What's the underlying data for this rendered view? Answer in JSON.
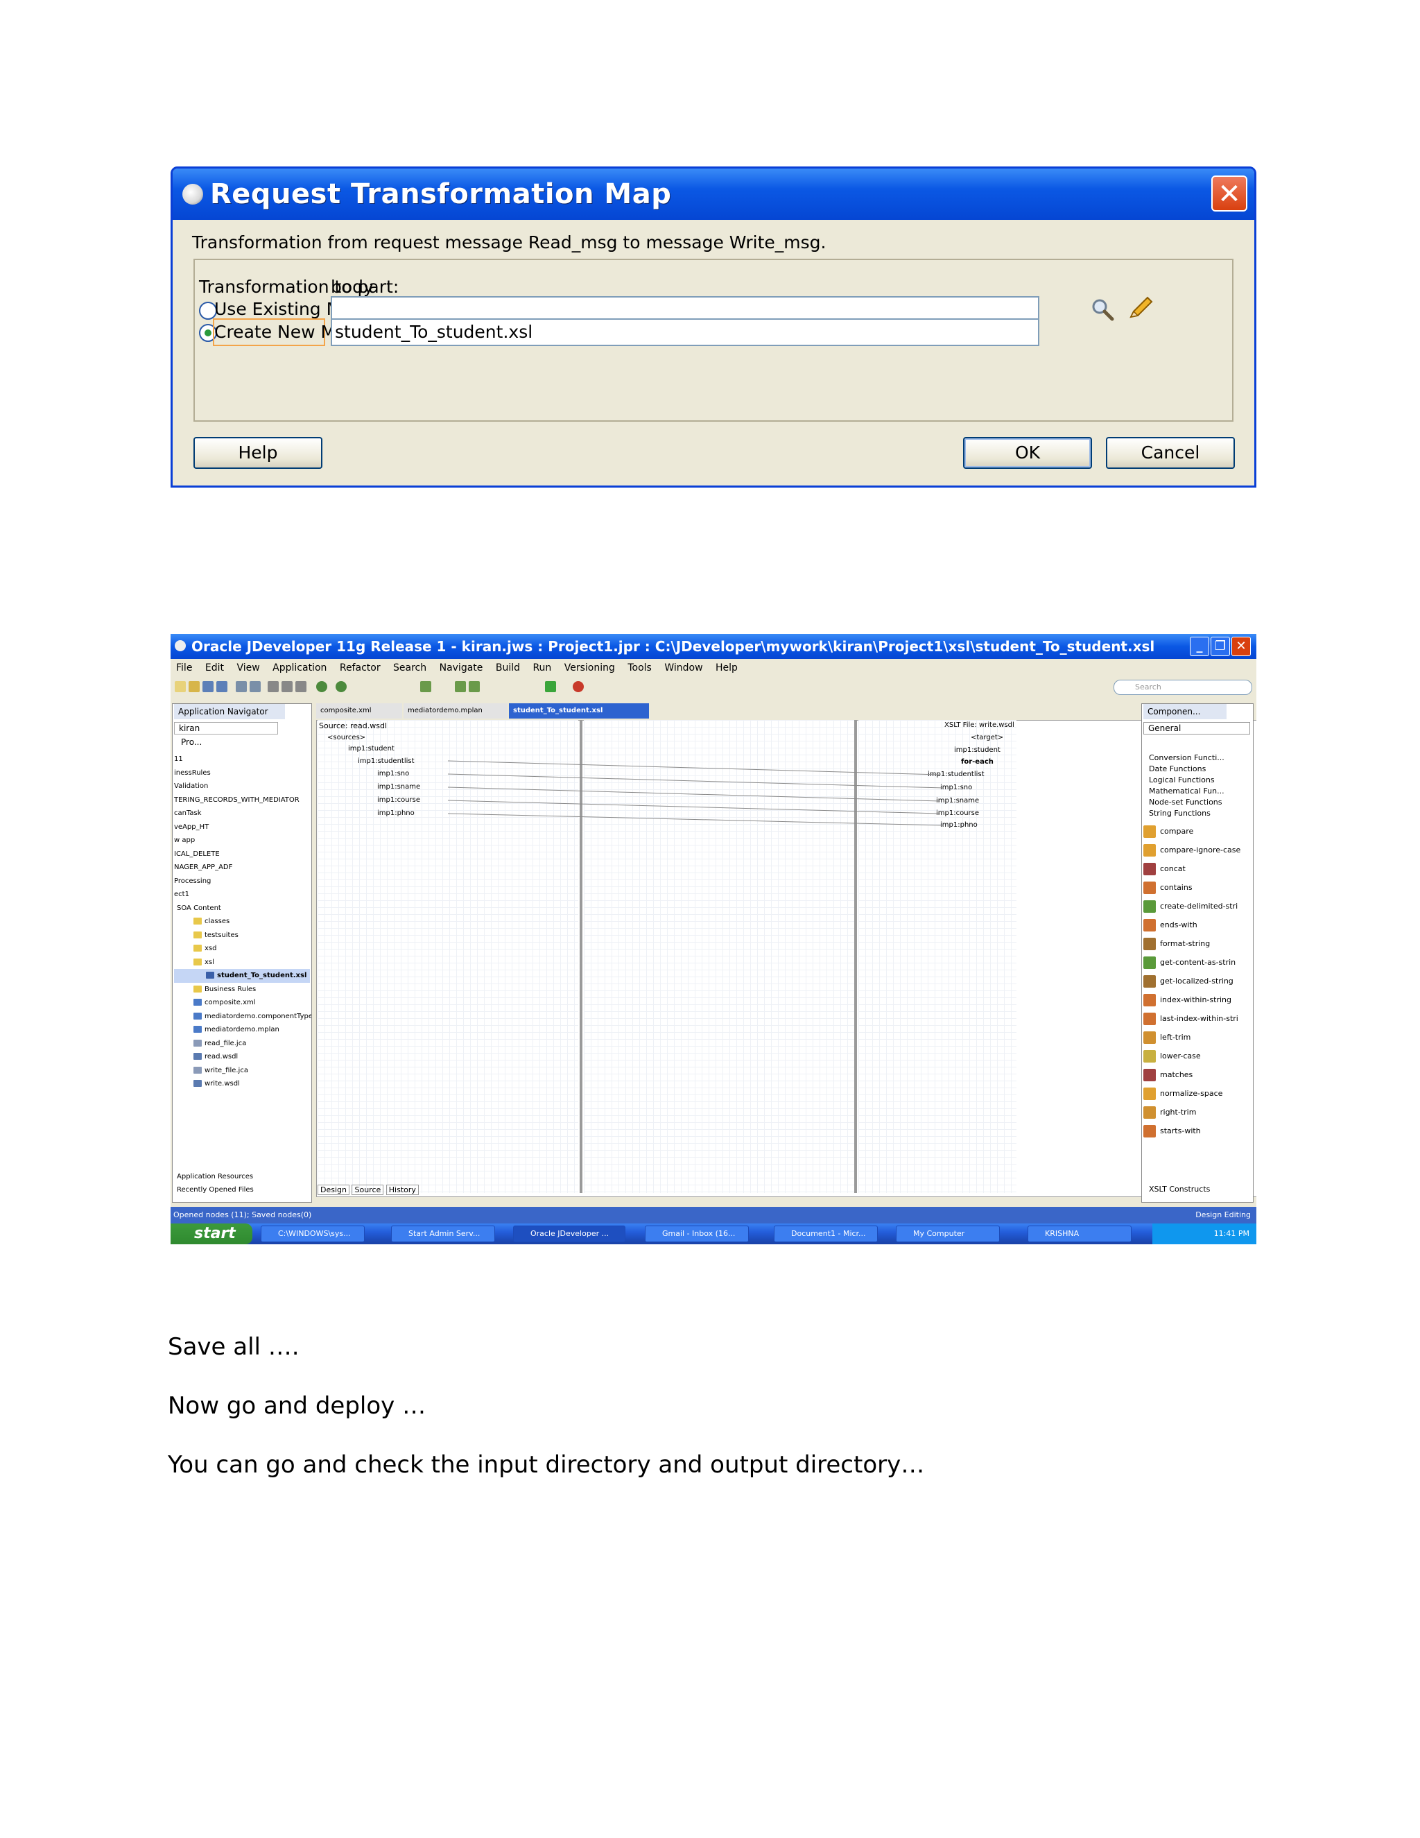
{
  "dialog": {
    "title": "Request Transformation Map",
    "close_label": "✕",
    "description": "Transformation from request message Read_msg to message Write_msg.",
    "part_label": "Transformation to part:",
    "part_value": "body",
    "use_existing_label": "Use Existing Mapper File:",
    "use_existing_value": "",
    "create_new_label": "Create New Mapper File:",
    "create_new_value": "student_To_student.xsl",
    "selected_option": "create_new",
    "help_label": "Help",
    "ok_label": "OK",
    "cancel_label": "Cancel"
  },
  "ide": {
    "title": "Oracle JDeveloper 11g Release 1 - kiran.jws : Project1.jpr : C:\\JDeveloper\\mywork\\kiran\\Project1\\xsl\\student_To_student.xsl",
    "window_buttons": [
      "_",
      "❐",
      "✕"
    ],
    "menu": [
      "File",
      "Edit",
      "View",
      "Application",
      "Refactor",
      "Search",
      "Navigate",
      "Build",
      "Run",
      "Versioning",
      "Tools",
      "Window",
      "Help"
    ],
    "search_placeholder": "Search",
    "navigator": {
      "tab": "Application Navigator",
      "app": "kiran",
      "project_label": "Pro...",
      "items": [
        "11",
        "inessRules",
        "Validation",
        "TERING_RECORDS_WITH_MEDIATOR",
        "canTask",
        "veApp_HT",
        "w app",
        "ICAL_DELETE",
        "NAGER_APP_ADF",
        "Processing",
        "ect1",
        "SOA Content",
        "classes",
        "testsuites",
        "xsd",
        "xsl",
        "student_To_student.xsl",
        "Business Rules",
        "composite.xml",
        "mediatordemo.componentType",
        "mediatordemo.mplan",
        "read_file.jca",
        "read.wsdl",
        "write_file.jca",
        "write.wsdl"
      ],
      "bottom": [
        "Application Resources",
        "Recently Opened Files"
      ]
    },
    "editor_tabs": [
      "composite.xml",
      "mediatordemo.mplan",
      "student_To_student.xsl"
    ],
    "source_header": "Source: read.wsdl",
    "target_header": "XSLT File: write.wsdl",
    "source_tree": [
      "<sources>",
      "imp1:student",
      "imp1:studentlist",
      "imp1:sno",
      "imp1:sname",
      "imp1:course",
      "imp1:phno"
    ],
    "target_tree": [
      "<target>",
      "imp1:student",
      "for-each",
      "imp1:studentlist",
      "imp1:sno",
      "imp1:sname",
      "imp1:course",
      "imp1:phno"
    ],
    "bottom_tabs": [
      "Design",
      "Source",
      "History"
    ],
    "palette": {
      "tab": "Componen...",
      "dropdown": "General",
      "categories": [
        "Conversion Functi...",
        "Date Functions",
        "Logical Functions",
        "Mathematical Fun...",
        "Node-set Functions",
        "String Functions"
      ],
      "functions": [
        "compare",
        "compare-ignore-case",
        "concat",
        "contains",
        "create-delimited-stri",
        "ends-with",
        "format-string",
        "get-content-as-strin",
        "get-localized-string",
        "index-within-string",
        "last-index-within-stri",
        "left-trim",
        "lower-case",
        "matches",
        "normalize-space",
        "right-trim",
        "starts-with"
      ],
      "footer": "XSLT Constructs"
    },
    "status_left": "Opened nodes (11); Saved nodes(0)",
    "status_right": "Design Editing",
    "taskbar": {
      "start": "start",
      "items": [
        "C:\\WINDOWS\\sys...",
        "Start Admin Serv...",
        "Oracle JDeveloper ...",
        "Gmail - Inbox (16...",
        "Document1 - Micr...",
        "My Computer",
        "KRISHNA"
      ],
      "clock": "11:41 PM"
    }
  },
  "paragraphs": [
    "Save all ….",
    "Now go and deploy …",
    "You can go and check the input directory and output directory…"
  ]
}
